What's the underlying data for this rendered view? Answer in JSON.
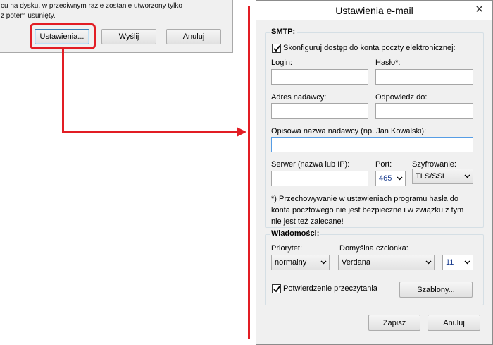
{
  "left_dialog": {
    "text_line_1": "cu na dysku, w przeciwnym razie zostanie utworzony tylko",
    "text_line_2": "z potem usunięty.",
    "settings_button": "Ustawienia...",
    "send_button": "Wyślij",
    "cancel_button": "Anuluj"
  },
  "dialog": {
    "title": "Ustawienia e-mail",
    "close_icon": "close-icon",
    "smtp": {
      "group_title": "SMTP:",
      "configure_checkbox_label": "Skonfiguruj dostęp do konta poczty elektronicznej:",
      "configure_checked": true,
      "login_label": "Login:",
      "login_value": "",
      "password_label": "Hasło*:",
      "password_value": "",
      "sender_address_label": "Adres nadawcy:",
      "sender_address_value": "",
      "reply_to_label": "Odpowiedz do:",
      "reply_to_value": "",
      "sender_name_label": "Opisowa nazwa nadawcy (np. Jan Kowalski):",
      "sender_name_value": "",
      "server_label": "Serwer (nazwa lub IP):",
      "server_value": "",
      "port_label": "Port:",
      "port_value": "465",
      "encryption_label": "Szyfrowanie:",
      "encryption_value": "TLS/SSL",
      "note_lines": [
        "*) Przechowywanie w ustawieniach programu hasła do",
        "konta pocztowego nie jest bezpieczne i w związku z tym",
        "nie jest też zalecane!"
      ]
    },
    "messages": {
      "group_title": "Wiadomości:",
      "priority_label": "Priorytet:",
      "priority_value": "normalny",
      "font_label": "Domyślna czcionka:",
      "font_value": "Verdana",
      "font_size_value": "11",
      "read_receipt_label": "Potwierdzenie przeczytania",
      "read_receipt_checked": true,
      "templates_button": "Szablony..."
    },
    "save_button": "Zapisz",
    "cancel_button": "Anuluj"
  },
  "colors": {
    "annotation_red": "#e21d24",
    "dialog_bg": "#f0f0f0",
    "focus_border": "#569de5"
  }
}
